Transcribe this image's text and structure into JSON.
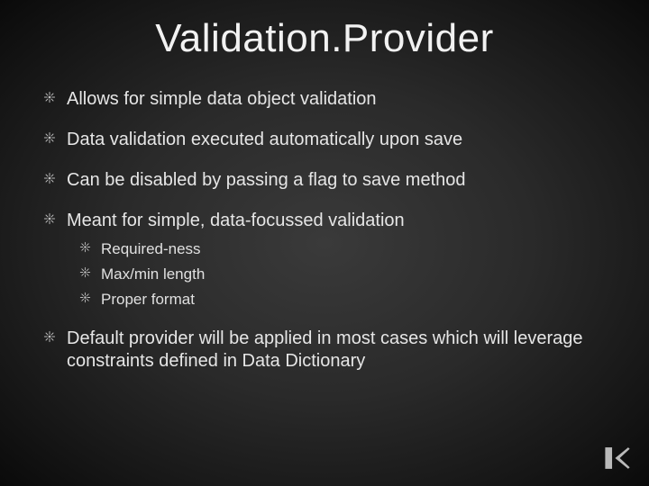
{
  "title": "Validation.Provider",
  "bullets": [
    {
      "text": "Allows for simple data object validation"
    },
    {
      "text": "Data validation executed automatically upon save"
    },
    {
      "text": "Can be disabled by passing a flag to save method"
    },
    {
      "text": "Meant for simple, data-focussed validation",
      "sub": [
        {
          "text": "Required-ness"
        },
        {
          "text": "Max/min length"
        },
        {
          "text": "Proper format"
        }
      ]
    },
    {
      "text": "Default provider will be applied in most cases which will leverage constraints defined in Data Dictionary"
    }
  ]
}
